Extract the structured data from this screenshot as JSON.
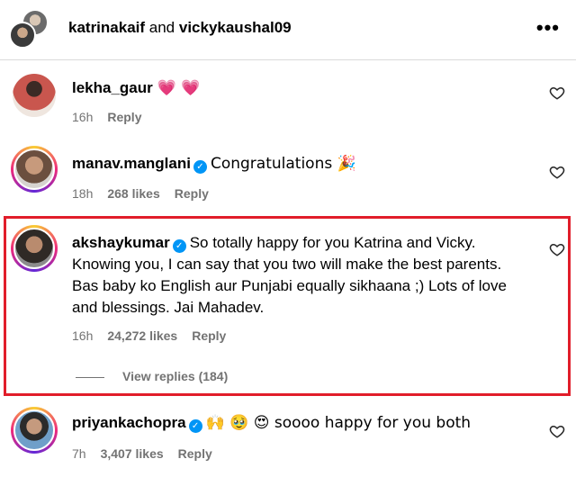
{
  "header": {
    "user1": "katrinakaif",
    "and": " and ",
    "user2": "vickykaushal09",
    "more": "•••"
  },
  "comments": [
    {
      "username": "lekha_gaur",
      "verified": false,
      "text": "💗 💗",
      "time": "16h",
      "likes": "",
      "reply": "Reply"
    },
    {
      "username": "manav.manglani",
      "verified": true,
      "text": "Congratulations 🎉",
      "time": "18h",
      "likes": "268 likes",
      "reply": "Reply"
    },
    {
      "username": "akshaykumar",
      "verified": true,
      "text": "So totally happy for you Katrina and Vicky. Knowing you, I can say that you two will make the best parents. Bas baby ko English aur Punjabi equally sikhaana ;) Lots of love and blessings. Jai Mahadev.",
      "time": "16h",
      "likes": "24,272 likes",
      "reply": "Reply",
      "view_replies": "View replies (184)"
    },
    {
      "username": "priyankachopra",
      "verified": true,
      "text": "🙌 🥹 😍 soooo happy for you both",
      "time": "7h",
      "likes": "3,407 likes",
      "reply": "Reply"
    }
  ],
  "icons": {
    "verified": "✓"
  }
}
